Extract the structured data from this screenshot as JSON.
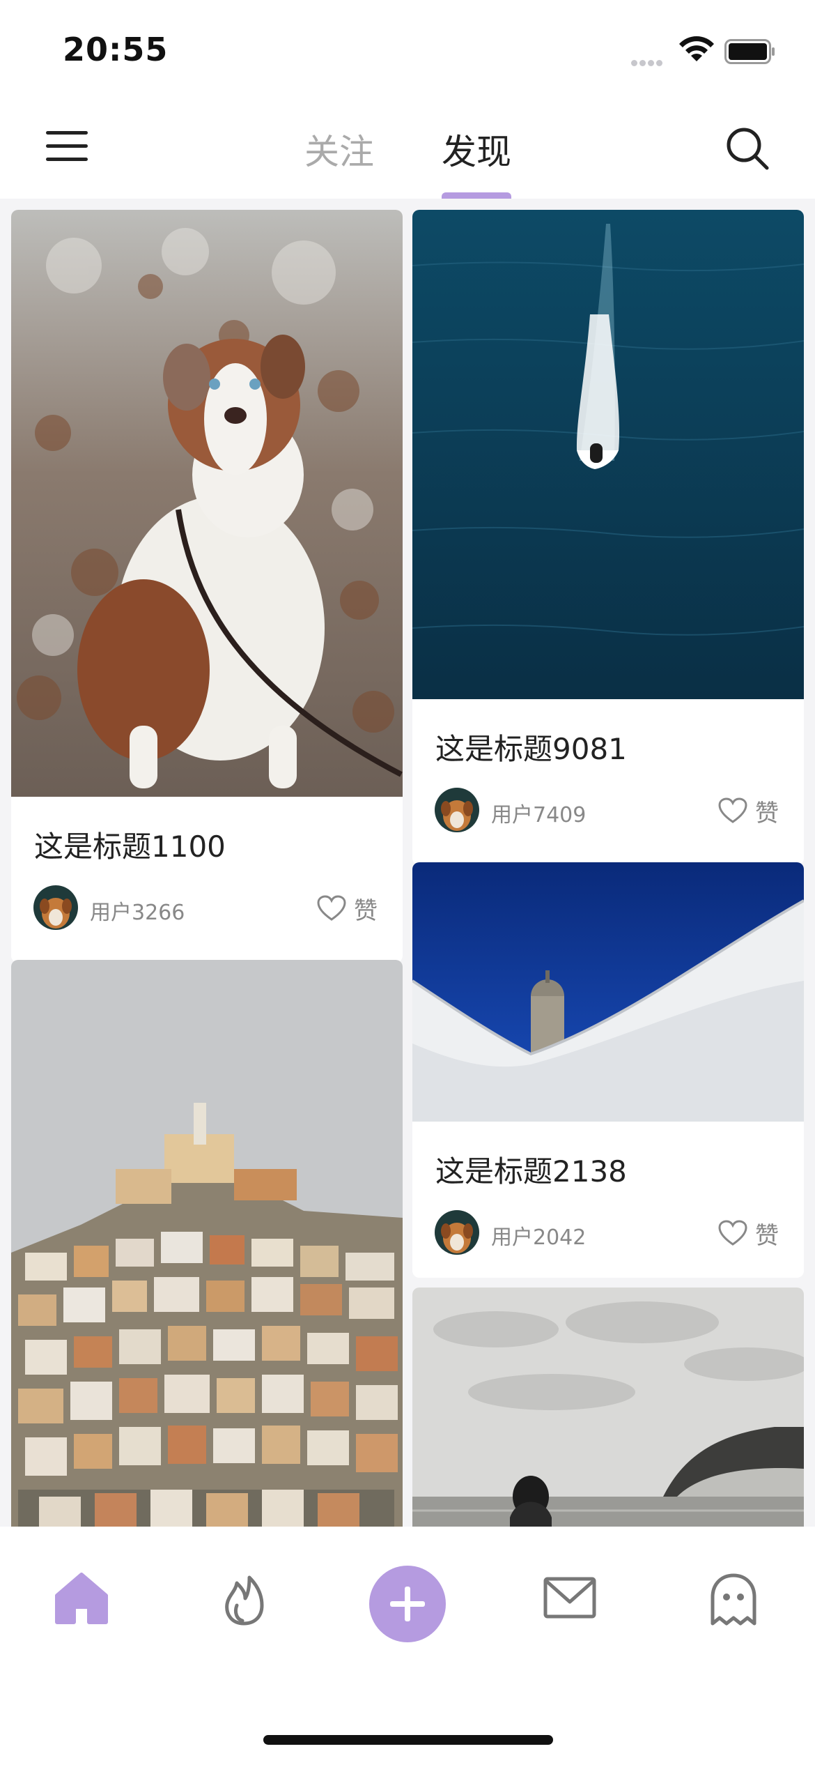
{
  "status_bar": {
    "time": "20:55"
  },
  "header": {
    "tabs": [
      {
        "label": "关注",
        "active": false
      },
      {
        "label": "发现",
        "active": true
      }
    ]
  },
  "theme": {
    "accent": "#b59be0",
    "background": "#f4f4f6"
  },
  "feed": {
    "cards": [
      {
        "image": "australian-shepherd-dog-photo",
        "title": "这是标题1100",
        "user": "用户3266",
        "like_label": "赞"
      },
      {
        "image": "speedboat-on-ocean-photo",
        "title": "这是标题9081",
        "user": "用户7409",
        "like_label": "赞"
      },
      {
        "image": "hillside-town-houses-photo",
        "title": "",
        "user": "",
        "like_label": ""
      },
      {
        "image": "white-sail-and-tower-photo",
        "title": "这是标题2138",
        "user": "用户2042",
        "like_label": "赞"
      },
      {
        "image": "beach-woman-bw-photo",
        "title": "",
        "user": "",
        "like_label": ""
      }
    ]
  },
  "tab_bar": {
    "items": [
      {
        "icon": "home-icon",
        "active": true
      },
      {
        "icon": "flame-icon",
        "active": false
      },
      {
        "icon": "add-icon",
        "active": false
      },
      {
        "icon": "mail-icon",
        "active": false
      },
      {
        "icon": "ghost-icon",
        "active": false
      }
    ]
  }
}
